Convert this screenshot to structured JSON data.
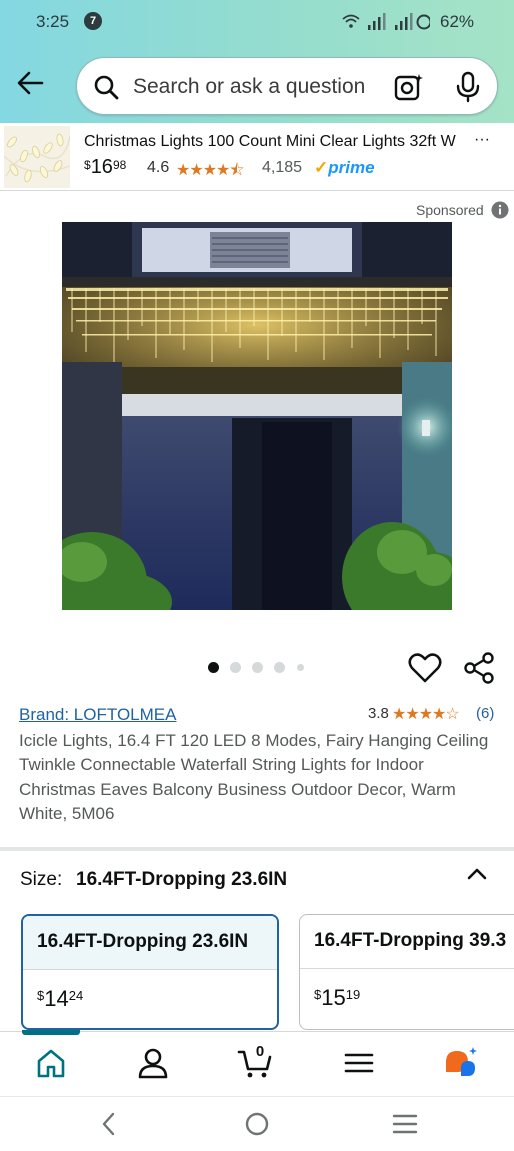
{
  "status_bar": {
    "time": "3:25",
    "notification_count": "7",
    "battery": "62%"
  },
  "search": {
    "placeholder": "Search or ask a question"
  },
  "sticky_product": {
    "title": "Christmas Lights 100 Count Mini Clear Lights 32ft W",
    "more": "···",
    "price_currency": "$",
    "price_whole": "16",
    "price_fraction": "98",
    "rating": "4.6",
    "stars": "★★★★⯪",
    "review_count": "4,185",
    "prime_label": "prime"
  },
  "sponsored_label": "Sponsored",
  "carousel": {
    "dot_count": 5,
    "active_index": 0
  },
  "product": {
    "brand_link": "Brand: LOFTOLMEA",
    "rating": "3.8",
    "stars": "★★★★☆",
    "review_count": "(6)",
    "title": "Icicle Lights, 16.4 FT 120 LED 8 Modes, Fairy Hanging Ceiling Twinkle Connectable Waterfall String Lights for Indoor Christmas Eaves Balcony Business Outdoor Decor, Warm White, 5M06"
  },
  "size_selector": {
    "label": "Size:",
    "selected_value": "16.4FT-Dropping 23.6IN",
    "options": [
      {
        "name": "16.4FT-Dropping 23.6IN",
        "currency": "$",
        "whole": "14",
        "fraction": "24",
        "selected": true
      },
      {
        "name": "16.4FT-Dropping 39.3",
        "currency": "$",
        "whole": "15",
        "fraction": "19",
        "selected": false
      }
    ]
  },
  "bottom_nav": {
    "cart_count": "0"
  },
  "colors": {
    "link": "#2162a1",
    "star": "#de7921",
    "teal_accent": "#007185",
    "prime_blue": "#1a98ff",
    "header_gradient_start": "#84d8e2",
    "header_gradient_end": "#a5e3c6"
  }
}
